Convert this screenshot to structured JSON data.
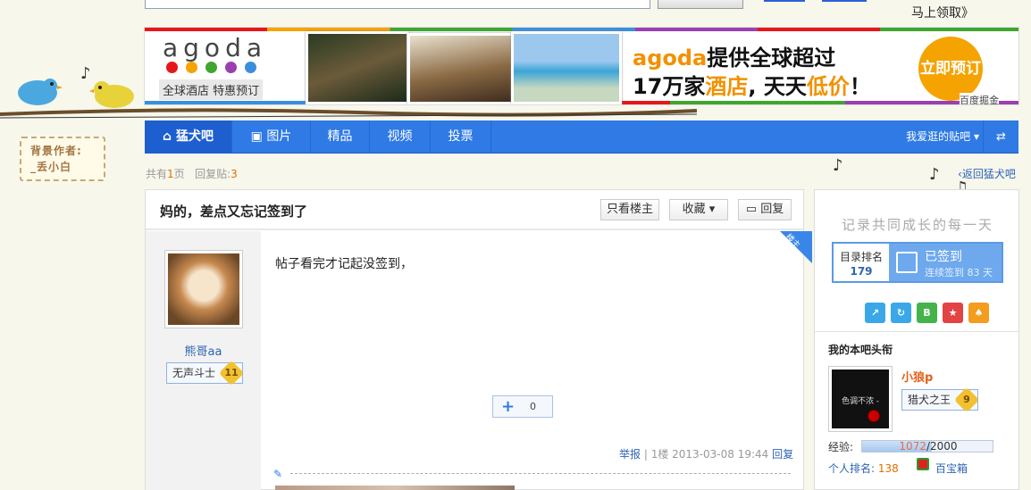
{
  "top": {
    "claim": "马上领取》"
  },
  "background": {
    "sign_line1": "背景作者:",
    "sign_line2": "_丢小白"
  },
  "banner": {
    "logo": "agoda",
    "logo_sub": "全球酒店 特惠预订",
    "line1_brand": "agoda",
    "line1_text": "提供全球超过",
    "line2_a": "17万家",
    "line2_b": "酒店",
    "line2_c": ", 天天",
    "line2_d": "低价",
    "line2_e": "！",
    "book": "立即预订",
    "source": "百度掘金",
    "dot_colors": [
      "#e5171b",
      "#f6a300",
      "#40a62f",
      "#9b3fb0",
      "#3a8fdd"
    ]
  },
  "nav": {
    "home": "猛犬吧",
    "items": [
      "图片",
      "精品",
      "视频",
      "投票"
    ],
    "visited": "我爱逛的贴吧",
    "switch_icon": "⇄"
  },
  "meta": {
    "pages_pre": "共有",
    "pages": "1",
    "pages_post": "页",
    "replies_pre": "回复贴:",
    "replies": "3",
    "back": "返回猛犬吧"
  },
  "post": {
    "title": "妈的，差点又忘记签到了",
    "btn_only_op": "只看楼主",
    "btn_fav": "收藏",
    "btn_reply": "回复",
    "author": "熊哥aa",
    "badge": "无声斗士",
    "badge_level": "11",
    "op_tag": "楼主",
    "content": "帖子看完才记起没签到，",
    "plus_count": "0",
    "report": "举报",
    "floor": "1楼",
    "time": "2013-03-08 19:44",
    "reply_link": "回复"
  },
  "side": {
    "slogan": "记录共同成长的每一天",
    "rank_label": "目录排名",
    "rank_value": "179",
    "signed": "已签到",
    "signed_days": "连续签到 83 天",
    "head_title": "我的本吧头衔",
    "head_pic_text": "色调不浓 -",
    "head_name": "小狼p",
    "head_badge": "猎犬之王",
    "head_level": "9",
    "exp_label": "经验:",
    "exp_cur": "1072",
    "exp_sep": "/",
    "exp_max": "2000",
    "exp_fraction": 0.536,
    "rank_label2": "个人排名:",
    "rank_value2": "138",
    "treasure": "百宝箱",
    "icons": [
      {
        "name": "share-icon",
        "color": "#3aa8e8",
        "glyph": "↗"
      },
      {
        "name": "refresh-icon",
        "color": "#3aa8e8",
        "glyph": "↻"
      },
      {
        "name": "b-icon",
        "color": "#44b34a",
        "glyph": "B"
      },
      {
        "name": "star-icon",
        "color": "#e34343",
        "glyph": "★"
      },
      {
        "name": "bell-icon",
        "color": "#f39c1e",
        "glyph": "♠"
      }
    ]
  }
}
